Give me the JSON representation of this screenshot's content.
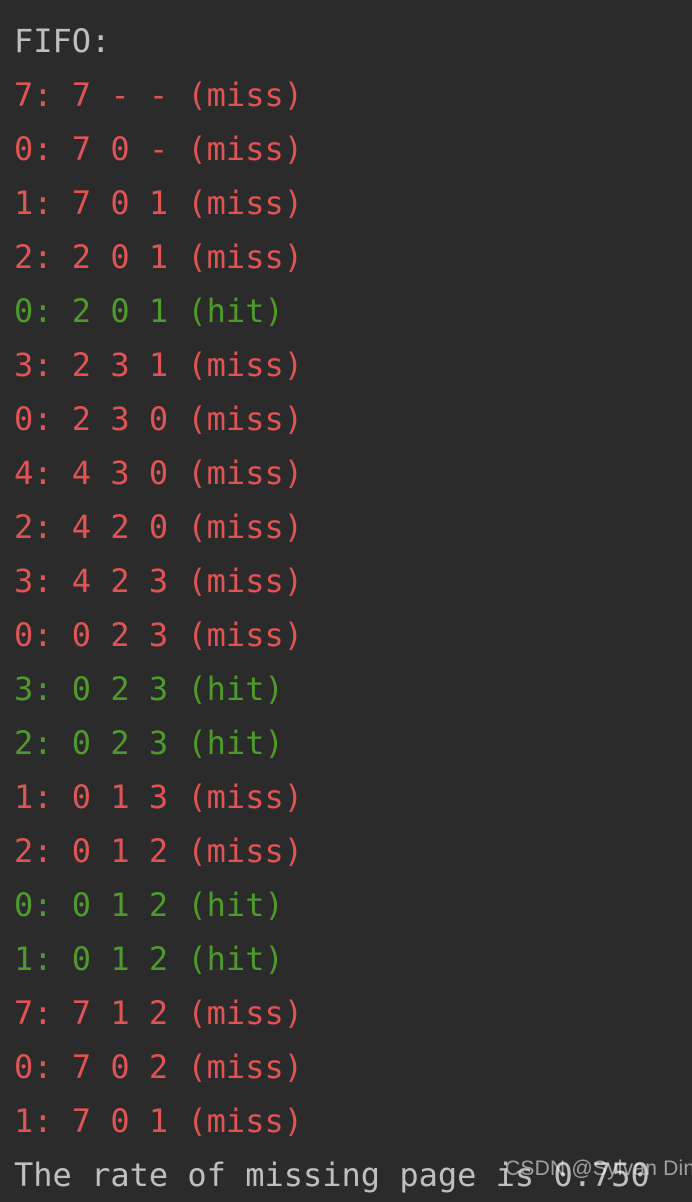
{
  "terminal": {
    "background_color": "#2b2b2b",
    "header": {
      "text": "FIFO:",
      "color": "#bfbfbf"
    },
    "colors": {
      "miss": "#df5555",
      "hit": "#4e9a2c",
      "neutral": "#bfbfbf"
    },
    "trace_lines": [
      {
        "text": "7: 7 - - (miss)",
        "status": "miss"
      },
      {
        "text": "0: 7 0 - (miss)",
        "status": "miss"
      },
      {
        "text": "1: 7 0 1 (miss)",
        "status": "miss"
      },
      {
        "text": "2: 2 0 1 (miss)",
        "status": "miss"
      },
      {
        "text": "0: 2 0 1 (hit)",
        "status": "hit"
      },
      {
        "text": "3: 2 3 1 (miss)",
        "status": "miss"
      },
      {
        "text": "0: 2 3 0 (miss)",
        "status": "miss"
      },
      {
        "text": "4: 4 3 0 (miss)",
        "status": "miss"
      },
      {
        "text": "2: 4 2 0 (miss)",
        "status": "miss"
      },
      {
        "text": "3: 4 2 3 (miss)",
        "status": "miss"
      },
      {
        "text": "0: 0 2 3 (miss)",
        "status": "miss"
      },
      {
        "text": "3: 0 2 3 (hit)",
        "status": "hit"
      },
      {
        "text": "2: 0 2 3 (hit)",
        "status": "hit"
      },
      {
        "text": "1: 0 1 3 (miss)",
        "status": "miss"
      },
      {
        "text": "2: 0 1 2 (miss)",
        "status": "miss"
      },
      {
        "text": "0: 0 1 2 (hit)",
        "status": "hit"
      },
      {
        "text": "1: 0 1 2 (hit)",
        "status": "hit"
      },
      {
        "text": "7: 7 1 2 (miss)",
        "status": "miss"
      },
      {
        "text": "0: 7 0 2 (miss)",
        "status": "miss"
      },
      {
        "text": "1: 7 0 1 (miss)",
        "status": "miss"
      }
    ],
    "summary": {
      "text": "The rate of missing page is 0.750"
    }
  },
  "watermark": {
    "text": "CSDN @Sylvan Ding"
  }
}
